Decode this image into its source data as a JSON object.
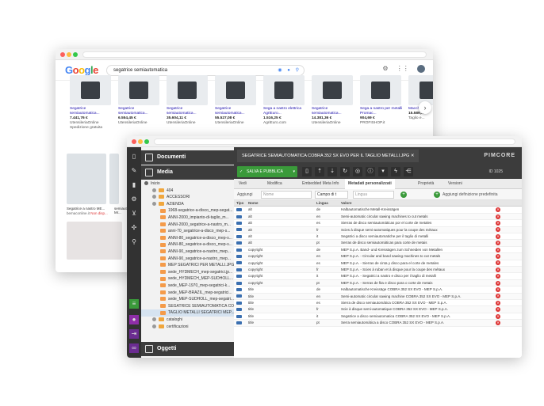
{
  "google": {
    "logo": "Google",
    "query": "segatrice semiautomatica",
    "products": [
      {
        "name": "Segatrice semiautomatica...",
        "price": "7.441,76 €",
        "store": "UtensileriaOnline",
        "note": "Spedizione gratuita"
      },
      {
        "name": "Segatrice semiautomatica...",
        "price": "6.554,45 €",
        "store": "UtensileriaOnline",
        "note": ""
      },
      {
        "name": "Segatrice semiautomatica...",
        "price": "35.604,11 €",
        "store": "UtensileriaOnline",
        "note": ""
      },
      {
        "name": "Segatrice semiautomatica...",
        "price": "55.527,08 €",
        "store": "UtensileriaOnline",
        "note": ""
      },
      {
        "name": "Sega a nastro elettrica AgriEuro...",
        "price": "1.516,25 €",
        "store": "AgriEuro.com",
        "note": ""
      },
      {
        "name": "Segatrice semiautomatica...",
        "price": "14.381,36 €",
        "store": "UtensileriaOnline",
        "note": ""
      },
      {
        "name": "Sega a nastro per metalli Promac...",
        "price": "904,69 €",
        "store": "PROFISHOP.it",
        "note": ""
      },
      {
        "name": "Macchina...",
        "price": "15.589,...",
        "store": "Taglio e...",
        "note": ""
      }
    ],
    "lower_caption": "Segatrice a nastro ME...",
    "lower_caption2": "semiautomatica Mr...",
    "lower_source": "bemaconline.it",
    "lower_extra": "Non disp..."
  },
  "pimcore": {
    "sections": {
      "documents": "Documenti",
      "media": "Media",
      "objects": "Oggetti"
    },
    "tree": [
      {
        "label": "Inizio",
        "indent": 0,
        "kind": "home"
      },
      {
        "label": "404",
        "indent": 1,
        "kind": "folder"
      },
      {
        "label": "ACCESSORI",
        "indent": 1,
        "kind": "folder"
      },
      {
        "label": "AZIENDA",
        "indent": 1,
        "kind": "folder"
      },
      {
        "label": "1968-segatrice-a-disco_mep-segat...",
        "indent": 2,
        "kind": "file"
      },
      {
        "label": "ANNI-2000_impianto-di-taglio_m...",
        "indent": 2,
        "kind": "file"
      },
      {
        "label": "ANNI-2000_segatrice-a-nastro_m...",
        "indent": 2,
        "kind": "file"
      },
      {
        "label": "anni-70_segatrice-a-disco_mep-s...",
        "indent": 2,
        "kind": "file"
      },
      {
        "label": "ANNI-80_segatrice-a-disco_mep-s...",
        "indent": 2,
        "kind": "file"
      },
      {
        "label": "ANNI-80_segatrice-a-disco_mep-s...",
        "indent": 2,
        "kind": "file"
      },
      {
        "label": "ANNI-90_segatrice-a-nastro_mep...",
        "indent": 2,
        "kind": "file"
      },
      {
        "label": "ANNI-90_segatrice-a-nastro_mep...",
        "indent": 2,
        "kind": "file"
      },
      {
        "label": "MEP SEGATRICI PER METALLI.JPG",
        "indent": 2,
        "kind": "file"
      },
      {
        "label": "sede_HYDMECH_mep-segatrici.jp...",
        "indent": 2,
        "kind": "file"
      },
      {
        "label": "sede_HYDMECH_MEP-SUDHOLL...",
        "indent": 2,
        "kind": "file"
      },
      {
        "label": "sede_MEP-1970_mep-segatrici-k...",
        "indent": 2,
        "kind": "file"
      },
      {
        "label": "sede_MEP-BRAZIL_mep-segatrici...",
        "indent": 2,
        "kind": "file"
      },
      {
        "label": "sede_MEP-SUDHOLL_mep-segatri...",
        "indent": 2,
        "kind": "file"
      },
      {
        "label": "SEGATRICE SEMIAUTOMATICA CO...",
        "indent": 2,
        "kind": "file"
      },
      {
        "label": "TAGLIO METALLI SEGATRICI MEP...",
        "indent": 2,
        "kind": "file",
        "selected": true
      },
      {
        "label": "cataloghi",
        "indent": 1,
        "kind": "folder"
      },
      {
        "label": "certificazioni",
        "indent": 1,
        "kind": "folder"
      }
    ],
    "tab_title": "SEGATRICE SEMIAUTOMATICA COBRA 352 SX EVO PER IL TAGLIO METALLI.JPG",
    "logo": "PIMCORE",
    "save_label": "SALVA E PUBBLICA",
    "item_id": "ID 1025",
    "subtabs": [
      "Vedi",
      "Modifica",
      "Embedded Meta Info",
      "Metadati personalizzati",
      "Proprietà",
      "Versioni"
    ],
    "active_subtab": "Metadati personalizzati",
    "filter": {
      "add_label": "Aggiungi",
      "name_placeholder": "Nome",
      "type_value": "Campo di t",
      "lang_placeholder": "Lingua",
      "predef_label": "Aggiungi definizione predefinita"
    },
    "columns": [
      "Tipo",
      "Nome",
      "Lingua",
      "Valore"
    ],
    "rows": [
      {
        "name": "alt",
        "lang": "de",
        "value": "Halbautomatische Metall-Kreissägen"
      },
      {
        "name": "alt",
        "lang": "en",
        "value": "Semi-automatic circular sawing machines to cut metals"
      },
      {
        "name": "alt",
        "lang": "es",
        "value": "Sierras de disco semiautomáticas por el corte de metales"
      },
      {
        "name": "alt",
        "lang": "fr",
        "value": "Scies à disque semi-automatiques pour la coupe des métaux"
      },
      {
        "name": "alt",
        "lang": "it",
        "value": "Segatrici a disco semiautomatiche per il taglio di metalli"
      },
      {
        "name": "alt",
        "lang": "pt",
        "value": "Serras de disco semiautomáticas para corte de metais"
      },
      {
        "name": "copyright",
        "lang": "de",
        "value": "MEP S.p.A. Band- und Kreissägen zum Schneiden von Metallen"
      },
      {
        "name": "copyright",
        "lang": "en",
        "value": "MEP S.p.A. - Circular and band sawing machines to cut metals"
      },
      {
        "name": "copyright",
        "lang": "es",
        "value": "MEP S.p.A. - Sierras de cinta y disco para el corte de metales"
      },
      {
        "name": "copyright",
        "lang": "fr",
        "value": "MEP S.p.A. - Scies à ruban et à disque pour la coupe des métaux"
      },
      {
        "name": "copyright",
        "lang": "it",
        "value": "MEP S.p.A. - Segatrici a nastro e disco per il taglio di metalli"
      },
      {
        "name": "copyright",
        "lang": "pt",
        "value": "MEP S.p.A. - Serras de fita e disco para o corte de metais"
      },
      {
        "name": "title",
        "lang": "de",
        "value": "Halbautomatische Kreissäge COBRA 352 SX EVO - MEP S.p.A."
      },
      {
        "name": "title",
        "lang": "en",
        "value": "Semi-automatic circular sawing machine COBRA 352 SX EVO - MEP S.p.A."
      },
      {
        "name": "title",
        "lang": "es",
        "value": "Sierra de disco semiautomática COBRA 352 SX EVO - MEP S.p.A."
      },
      {
        "name": "title",
        "lang": "fr",
        "value": "Scie à disque semi-automatique COBRA 352 SX EVO - MEP S.p.A."
      },
      {
        "name": "title",
        "lang": "it",
        "value": "Segatrice a disco semiautomatica COBRA 352 SX EVO - MEP S.p.A."
      },
      {
        "name": "title",
        "lang": "pt",
        "value": "Serra semiautomática a disco COBRA 352 SX EVO - MEP S.p.A."
      }
    ]
  },
  "colors": {
    "pimcore_dark": "#3c3c3c",
    "save_green": "#3a9a3a",
    "folder_orange": "#f0a63c",
    "delete_red": "#d33333",
    "google_link": "#1a0dab"
  }
}
